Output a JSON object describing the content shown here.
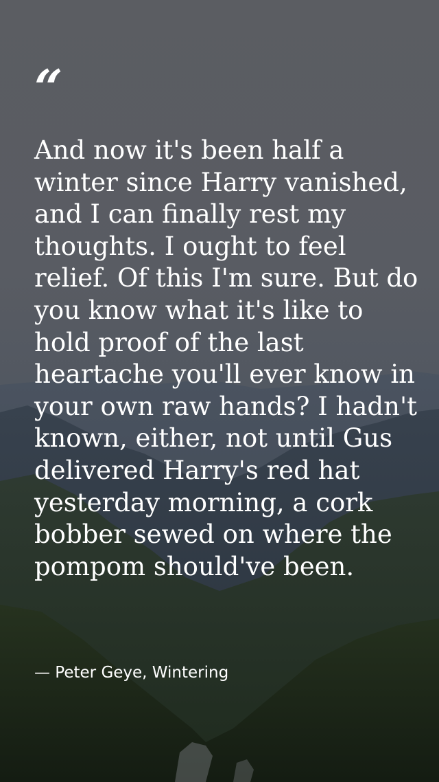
{
  "quote": {
    "mark": "“",
    "text": "And now it's been half a winter since Harry vanished, and I can finally rest my thoughts. I ought to feel relief. Of this I'm sure. But do you know what it's like to hold proof of the last heartache you'll ever know in your own raw hands? I hadn't known, either, not until Gus delivered Harry's red hat yesterday morning, a cork bobber sewed on where the pompom should've been.",
    "attribution": "— Peter Geye, Wintering"
  },
  "colors": {
    "sky": "#5b5d62",
    "text": "#ffffff",
    "mountain_dark": "#2a3340",
    "forest": "#2c3a28"
  }
}
